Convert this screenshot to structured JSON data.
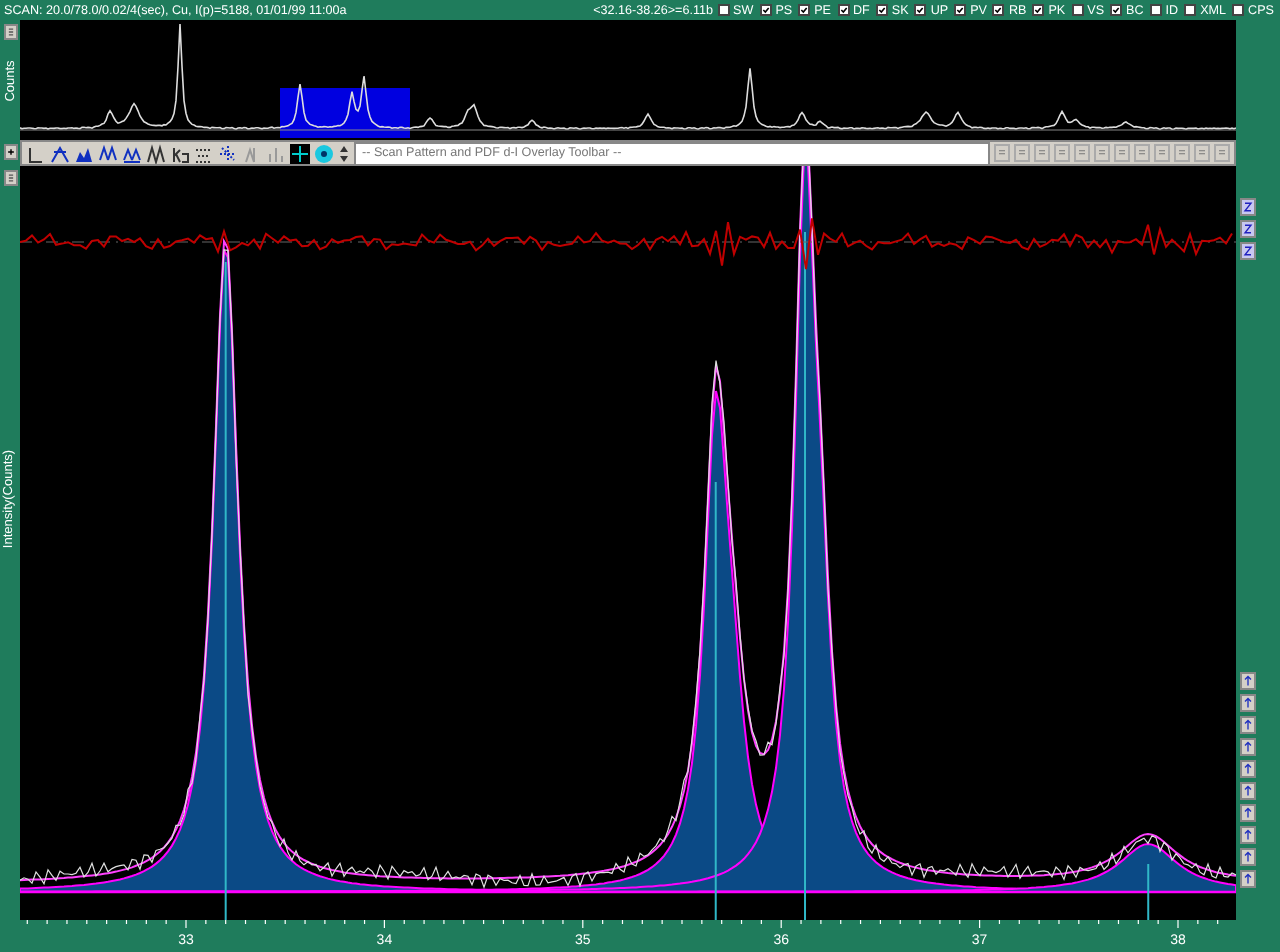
{
  "status_bar": {
    "scan_info": "SCAN: 20.0/78.0/0.02/4(sec), Cu, I(p)=5188, 01/01/99 11:00a",
    "range": "<32.16-38.26>=6.11b",
    "options": [
      {
        "label": "SW",
        "checked": false
      },
      {
        "label": "PS",
        "checked": true
      },
      {
        "label": "PE",
        "checked": true
      },
      {
        "label": "DF",
        "checked": true
      },
      {
        "label": "SK",
        "checked": true
      },
      {
        "label": "UP",
        "checked": true
      },
      {
        "label": "PV",
        "checked": true
      },
      {
        "label": "RB",
        "checked": true
      },
      {
        "label": "PK",
        "checked": true
      },
      {
        "label": "VS",
        "checked": false
      },
      {
        "label": "BC",
        "checked": true
      },
      {
        "label": "ID",
        "checked": false
      },
      {
        "label": "XML",
        "checked": false
      },
      {
        "label": "CPS",
        "checked": false
      }
    ]
  },
  "overview": {
    "ylabel": "Counts"
  },
  "toolbar": {
    "title": "-- Scan Pattern and PDF d-I Overlay Toolbar --"
  },
  "main_plot": {
    "ylabel": "Intensity(Counts)",
    "x_tick_labels": [
      "33",
      "34",
      "35",
      "36",
      "37",
      "38"
    ]
  }
}
